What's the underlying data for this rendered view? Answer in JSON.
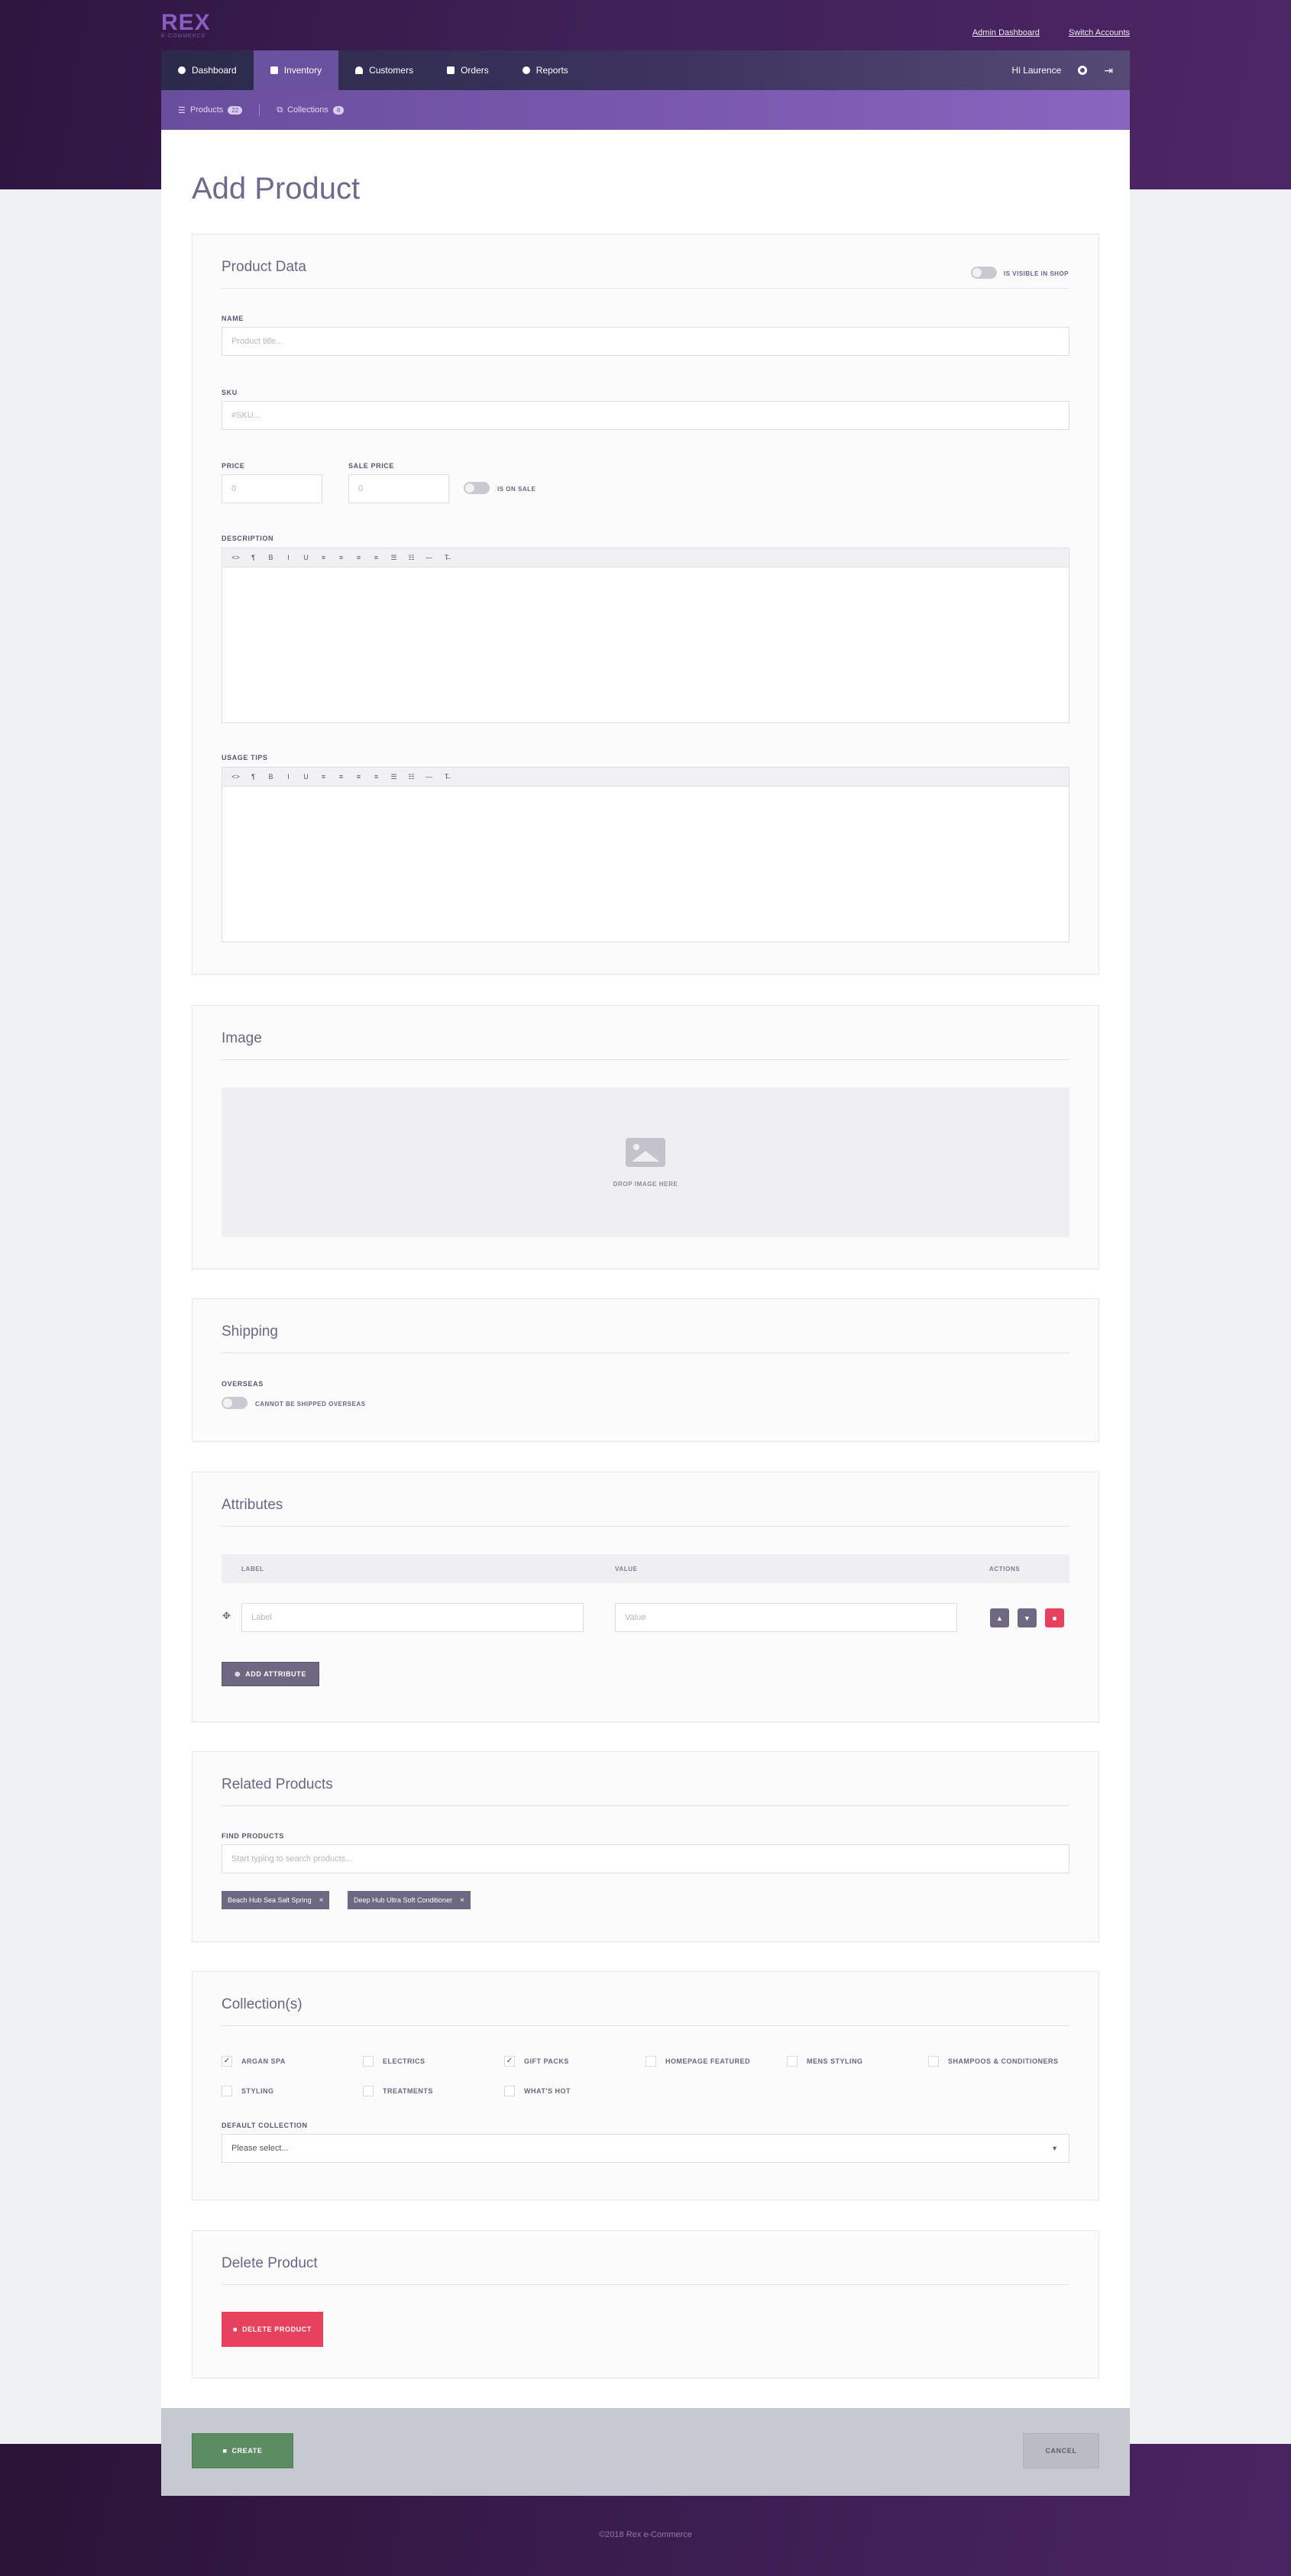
{
  "brand": {
    "name": "REX",
    "tagline": "E-COMMERCE"
  },
  "top_links": {
    "admin": "Admin Dashboard",
    "switch": "Switch Accounts"
  },
  "nav": {
    "items": [
      {
        "label": "Dashboard",
        "icon": "dashboard-icon"
      },
      {
        "label": "Inventory",
        "icon": "inventory-icon",
        "active": true
      },
      {
        "label": "Customers",
        "icon": "customers-icon"
      },
      {
        "label": "Orders",
        "icon": "truck-icon"
      },
      {
        "label": "Reports",
        "icon": "chart-icon"
      }
    ],
    "greeting": "Hi Laurence"
  },
  "subnav": {
    "products": {
      "label": "Products",
      "count": "22"
    },
    "collections": {
      "label": "Collections",
      "count": "8"
    }
  },
  "page_title": "Add Product",
  "product_data": {
    "title": "Product Data",
    "visible_toggle": "IS VISIBLE IN SHOP",
    "name_label": "NAME",
    "name_placeholder": "Product title...",
    "sku_label": "SKU",
    "sku_placeholder": "#SKU...",
    "price_label": "PRICE",
    "price_placeholder": "0",
    "sale_price_label": "SALE PRICE",
    "sale_price_placeholder": "0",
    "on_sale_toggle": "IS ON SALE",
    "description_label": "DESCRIPTION",
    "usage_label": "USAGE TIPS",
    "toolbar": [
      "<>",
      "¶",
      "B",
      "I",
      "U",
      "≡",
      "≡",
      "≡",
      "≡",
      "☰",
      "☷",
      "—",
      "T̶"
    ]
  },
  "image": {
    "title": "Image",
    "drop_text": "DROP IMAGE HERE"
  },
  "shipping": {
    "title": "Shipping",
    "overseas_label": "OVERSEAS",
    "overseas_toggle": "CANNOT BE SHIPPED OVERSEAS"
  },
  "attributes": {
    "title": "Attributes",
    "col_label": "LABEL",
    "col_value": "VALUE",
    "col_actions": "ACTIONS",
    "label_placeholder": "Label",
    "value_placeholder": "Value",
    "add_button": "ADD ATTRIBUTE"
  },
  "related": {
    "title": "Related Products",
    "find_label": "FIND PRODUCTS",
    "search_placeholder": "Start typing to search products...",
    "tags": [
      "Beach Hub Sea Salt Spring",
      "Deep Hub Ultra Soft Conditioner"
    ]
  },
  "collections": {
    "title": "Collection(s)",
    "items": [
      {
        "label": "ARGAN SPA",
        "checked": true
      },
      {
        "label": "ELECTRICS",
        "checked": false
      },
      {
        "label": "GIFT PACKS",
        "checked": true
      },
      {
        "label": "HOMEPAGE FEATURED",
        "checked": false
      },
      {
        "label": "MENS STYLING",
        "checked": false
      },
      {
        "label": "SHAMPOOS & CONDITIONERS",
        "checked": false
      },
      {
        "label": "STYLING",
        "checked": false
      },
      {
        "label": "TREATMENTS",
        "checked": false
      },
      {
        "label": "WHAT'S HOT",
        "checked": false
      }
    ],
    "default_label": "DEFAULT COLLECTION",
    "default_value": "Please select..."
  },
  "delete": {
    "title": "Delete Product",
    "button": "DELETE PRODUCT"
  },
  "footer_actions": {
    "create": "CREATE",
    "cancel": "CANCEL"
  },
  "copyright": "©2018 Rex e-Commerce",
  "colors": {
    "brand": "#6a52a0",
    "danger": "#e8415e",
    "success": "#5b8c62"
  }
}
